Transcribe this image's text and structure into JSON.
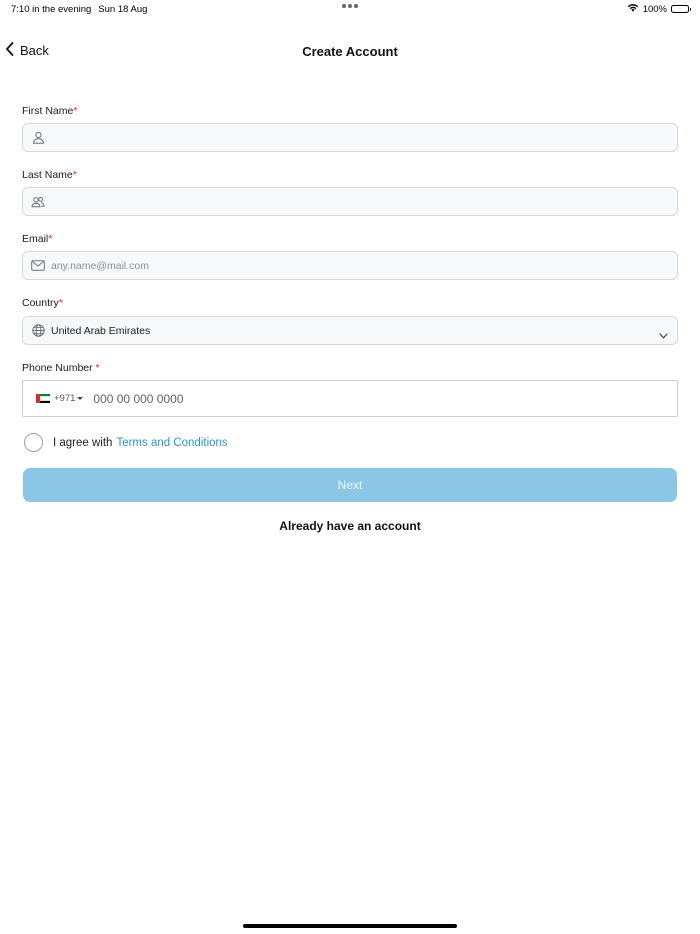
{
  "status_bar": {
    "time": "7:10 in the evening",
    "date": "Sun 18 Aug",
    "battery": "100%",
    "battery_level": 1.0
  },
  "nav": {
    "back_label": "Back",
    "title": "Create Account"
  },
  "form": {
    "first_name": {
      "label": "First Name",
      "required_mark": "*",
      "placeholder": "",
      "icon": "person-icon"
    },
    "last_name": {
      "label": "Last Name",
      "required_mark": "*",
      "placeholder": "",
      "icon": "people-icon"
    },
    "email": {
      "label": "Email",
      "required_mark": "*",
      "placeholder": "any.name@mail.com",
      "icon": "mail-icon"
    },
    "country": {
      "label": "Country",
      "required_mark": "*",
      "selected": "United Arab Emirates",
      "icon": "globe-icon"
    },
    "phone": {
      "label": "Phone Number ",
      "required_mark": "*",
      "dial_code": "+971",
      "placeholder": "000 00 000 0000",
      "flag": "uae-flag-icon"
    }
  },
  "agreement": {
    "text": "I agree with",
    "link": "Terms and Conditions",
    "checked": false
  },
  "actions": {
    "next_label": "Next",
    "login_label": "Already have an account"
  },
  "colors": {
    "accent": "#2e95c8",
    "button_disabled": "#8cc6e6",
    "required": "#d32f2f",
    "input_bg": "#f7f8fa"
  }
}
